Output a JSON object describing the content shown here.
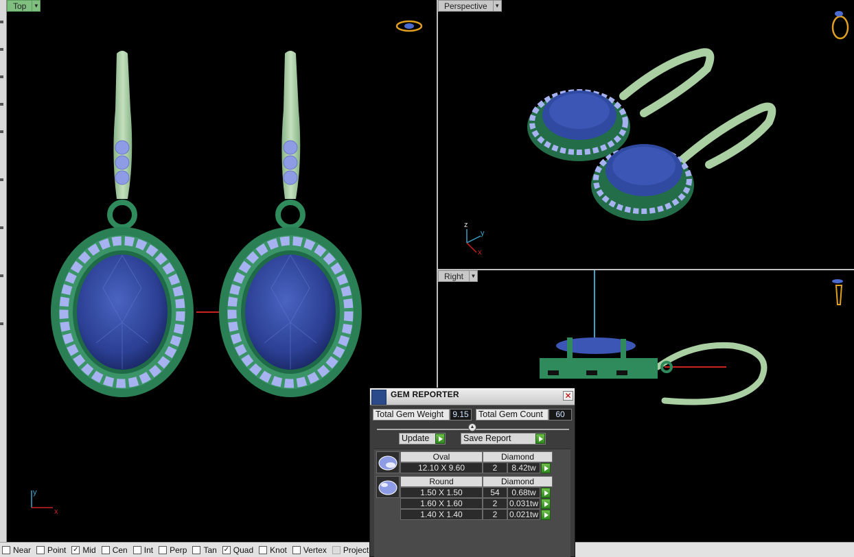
{
  "viewports": {
    "top": {
      "label": "Top"
    },
    "perspective": {
      "label": "Perspective"
    },
    "right": {
      "label": "Right"
    }
  },
  "axes": {
    "x": "x",
    "y": "y",
    "z": "z"
  },
  "statusbar": {
    "snaps": [
      {
        "label": "Near",
        "checked": false
      },
      {
        "label": "Point",
        "checked": false
      },
      {
        "label": "Mid",
        "checked": true
      },
      {
        "label": "Cen",
        "checked": false
      },
      {
        "label": "Int",
        "checked": false
      },
      {
        "label": "Perp",
        "checked": false
      },
      {
        "label": "Tan",
        "checked": false
      },
      {
        "label": "Quad",
        "checked": true
      },
      {
        "label": "Knot",
        "checked": false
      },
      {
        "label": "Vertex",
        "checked": false
      },
      {
        "label": "Project",
        "checked": false
      }
    ]
  },
  "gem_reporter": {
    "title": "GEM REPORTER",
    "total_weight_label": "Total Gem Weight",
    "total_weight_value": "9.15",
    "total_count_label": "Total Gem Count",
    "total_count_value": "60",
    "update_label": "Update",
    "save_label": "Save Report",
    "groups": [
      {
        "shape": "Oval",
        "material": "Diamond",
        "rows": [
          {
            "size": "12.10 X 9.60",
            "count": "2",
            "weight": "8.42tw"
          }
        ]
      },
      {
        "shape": "Round",
        "material": "Diamond",
        "rows": [
          {
            "size": "1.50 X 1.50",
            "count": "54",
            "weight": "0.68tw"
          },
          {
            "size": "1.60 X 1.60",
            "count": "2",
            "weight": "0.031tw"
          },
          {
            "size": "1.40 X 1.40",
            "count": "2",
            "weight": "0.021tw"
          }
        ]
      }
    ]
  },
  "colors": {
    "metal": "#2f8a5c",
    "hook": "#a9cfa3",
    "sapphire": "#2f4aa0",
    "diamond": "#9aa6ec",
    "axis_x": "#c22",
    "axis_y": "#3aa3c9",
    "active_tab": "#7fbf7f"
  }
}
